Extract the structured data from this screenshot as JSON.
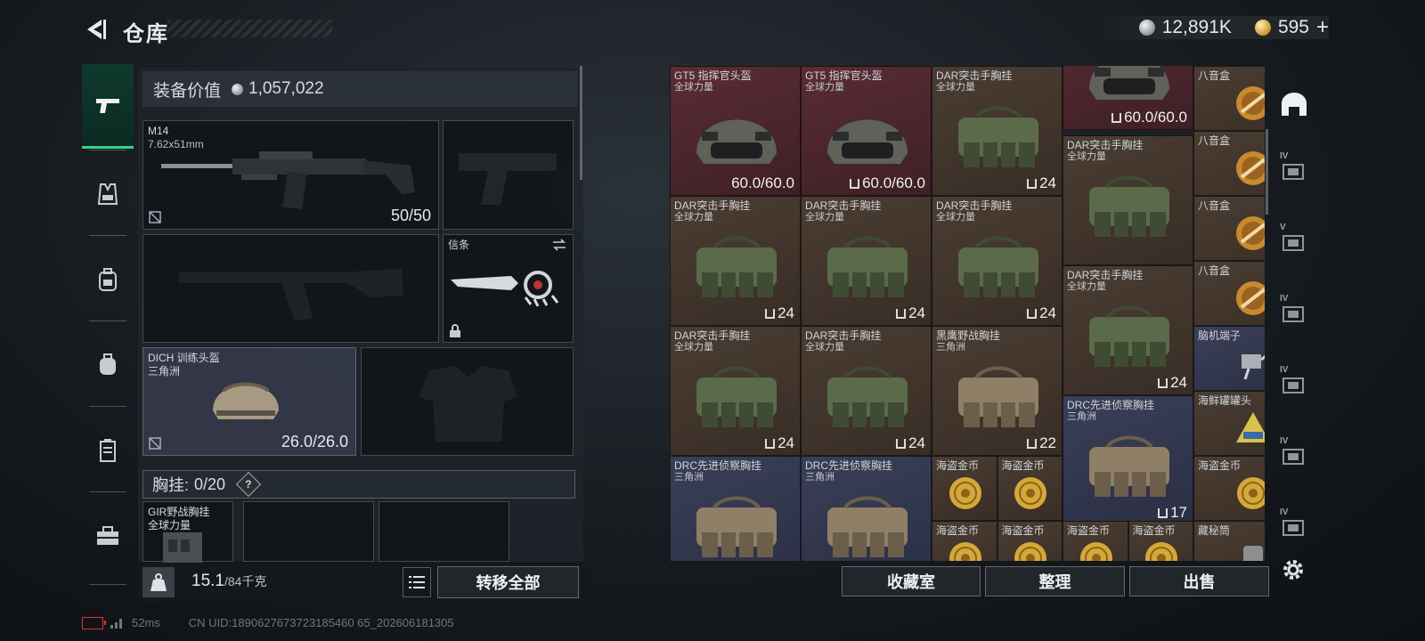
{
  "header": {
    "title": "仓库",
    "currency_silver": "12,891K",
    "currency_gold": "595",
    "currency_plus": "+"
  },
  "equipment": {
    "value_label": "装备价值",
    "value": "1,057,022",
    "primary_weapon": {
      "name": "M14",
      "ammo": "7.62x51mm",
      "durability": "50/50"
    },
    "knife": {
      "name": "信条"
    },
    "helmet": {
      "name": "DICH 训练头盔",
      "origin": "三角洲",
      "durability": "26.0/26.0"
    },
    "chest_rig_bar": {
      "label": "胸挂:",
      "value": "0/20",
      "help": "?"
    },
    "chest_rig_item": {
      "name": "GIR野战胸挂",
      "origin": "全球力量"
    }
  },
  "bottom_left": {
    "weight_value": "15.1",
    "weight_max": "/84千克",
    "transfer_all": "转移全部"
  },
  "status": {
    "ping": "52ms",
    "uid": "CN UID:1890627673723185460 65_202606181305"
  },
  "storage": {
    "items": [
      {
        "n1": "GT5 指挥官头盔",
        "n2": "全球力量",
        "count": "60.0/60.0",
        "bg": "red"
      },
      {
        "n1": "GT5 指挥官头盔",
        "n2": "全球力量",
        "count": "60.0/60.0",
        "bg": "red"
      },
      {
        "n1": "DAR突击手胸挂",
        "n2": "全球力量",
        "count": "24",
        "bg": "brown"
      },
      {
        "n1": "",
        "n2": "",
        "count": "60.0/60.0",
        "bg": "red"
      },
      {
        "n1": "八音盒",
        "n2": "",
        "count": "",
        "bg": "gold"
      },
      {
        "n1": "DAR突击手胸挂",
        "n2": "全球力量",
        "count": "",
        "bg": "brown"
      },
      {
        "n1": "八音盒",
        "n2": "",
        "count": "",
        "bg": "gold"
      },
      {
        "n1": "DAR突击手胸挂",
        "n2": "全球力量",
        "count": "24",
        "bg": "brown"
      },
      {
        "n1": "DAR突击手胸挂",
        "n2": "全球力量",
        "count": "24",
        "bg": "brown"
      },
      {
        "n1": "DAR突击手胸挂",
        "n2": "全球力量",
        "count": "24",
        "bg": "brown"
      },
      {
        "n1": "八音盒",
        "n2": "",
        "count": "",
        "bg": "gold"
      },
      {
        "n1": "DAR突击手胸挂",
        "n2": "全球力量",
        "count": "24",
        "bg": "brown"
      },
      {
        "n1": "八音盒",
        "n2": "",
        "count": "",
        "bg": "gold"
      },
      {
        "n1": "DAR突击手胸挂",
        "n2": "全球力量",
        "count": "24",
        "bg": "brown"
      },
      {
        "n1": "DAR突击手胸挂",
        "n2": "全球力量",
        "count": "24",
        "bg": "brown"
      },
      {
        "n1": "黑鹰野战胸挂",
        "n2": "三角洲",
        "count": "22",
        "bg": "brown"
      },
      {
        "n1": "脑机端子",
        "n2": "",
        "count": "",
        "bg": "blue"
      },
      {
        "n1": "DRC先进侦察胸挂",
        "n2": "三角洲",
        "count": "17",
        "bg": "blue"
      },
      {
        "n1": "海鲜罐罐头",
        "n2": "",
        "count": "",
        "bg": "brown"
      },
      {
        "n1": "DRC先进侦察胸挂",
        "n2": "三角洲",
        "count": "",
        "bg": "blue"
      },
      {
        "n1": "DRC先进侦察胸挂",
        "n2": "三角洲",
        "count": "",
        "bg": "blue"
      },
      {
        "n1": "海盗金币",
        "n2": "",
        "count": "",
        "bg": "brown"
      },
      {
        "n1": "海盗金币",
        "n2": "",
        "count": "",
        "bg": "brown"
      },
      {
        "n1": "海盗金币",
        "n2": "",
        "count": "",
        "bg": "brown"
      },
      {
        "n1": "海盗金币",
        "n2": "",
        "count": "",
        "bg": "brown"
      },
      {
        "n1": "海盗金币",
        "n2": "",
        "count": "",
        "bg": "brown"
      },
      {
        "n1": "海盗金币",
        "n2": "",
        "count": "",
        "bg": "brown"
      },
      {
        "n1": "海盗金币",
        "n2": "",
        "count": "",
        "bg": "brown"
      },
      {
        "n1": "藏秘筒",
        "n2": "",
        "count": "",
        "bg": "brown"
      }
    ]
  },
  "bottom_right": {
    "collection": "收藏室",
    "organize": "整理",
    "sell": "出售"
  },
  "right_nav_tags": [
    "IV",
    "V",
    "IV",
    "IV",
    "IV",
    "IV"
  ]
}
